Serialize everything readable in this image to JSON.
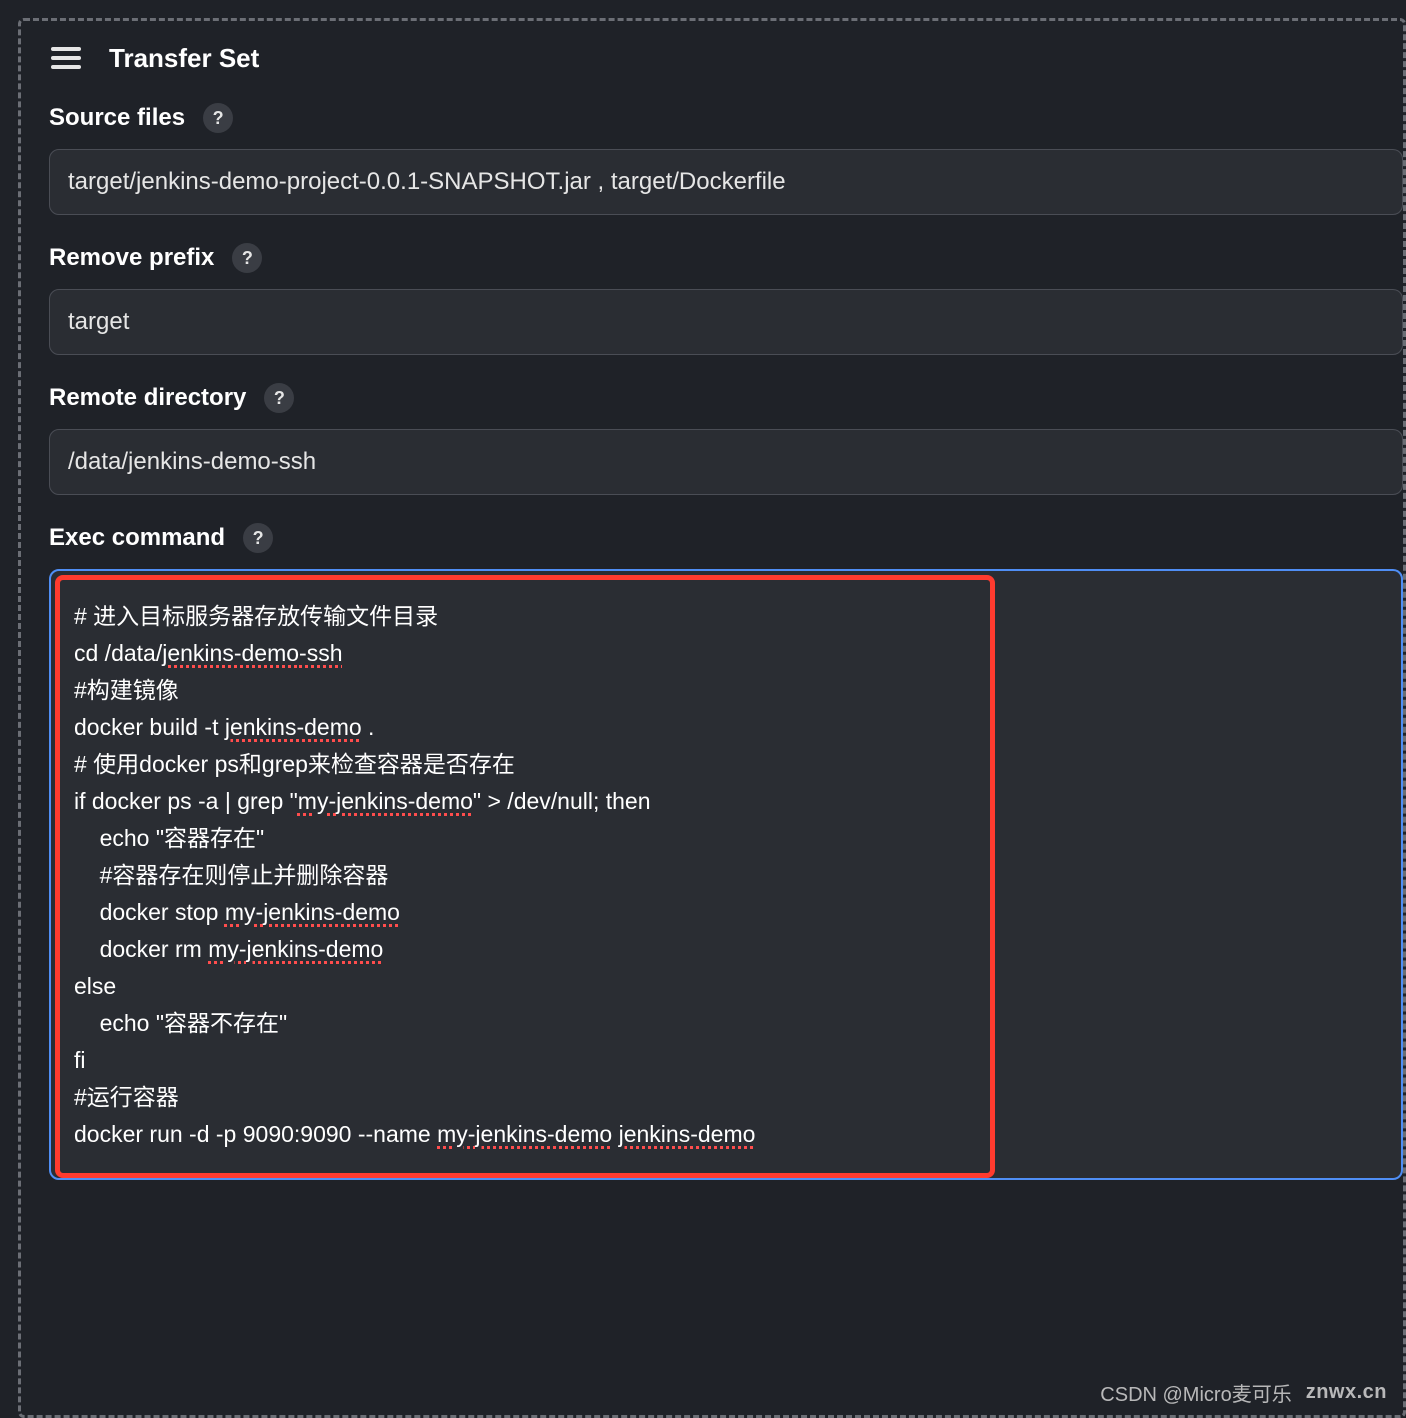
{
  "header": {
    "title": "Transfer Set"
  },
  "fields": {
    "source_files": {
      "label": "Source files",
      "value": "target/jenkins-demo-project-0.0.1-SNAPSHOT.jar , target/Dockerfile"
    },
    "remove_prefix": {
      "label": "Remove prefix",
      "value": "target"
    },
    "remote_directory": {
      "label": "Remote directory",
      "value": "/data/jenkins-demo-ssh"
    },
    "exec_command": {
      "label": "Exec command",
      "value": "# 进入目标服务器存放传输文件目录\ncd /data/jenkins-demo-ssh\n#构建镜像\ndocker build -t jenkins-demo .\n# 使用docker ps和grep来检查容器是否存在\nif docker ps -a | grep \"my-jenkins-demo\" > /dev/null; then\n    echo \"容器存在\"\n    #容器存在则停止并删除容器\n    docker stop my-jenkins-demo\n    docker rm my-jenkins-demo\nelse\n    echo \"容器不存在\"\nfi\n#运行容器\ndocker run -d -p 9090:9090 --name my-jenkins-demo jenkins-demo"
    }
  },
  "help_glyph": "?",
  "watermark": {
    "left": "CSDN @Micro麦可乐",
    "right": "znwx.cn"
  }
}
